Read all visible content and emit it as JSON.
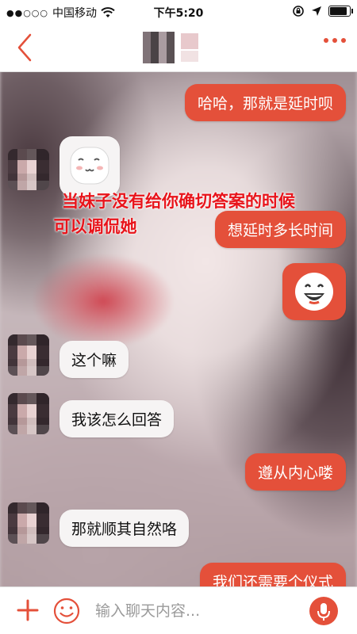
{
  "status_bar": {
    "signal_dots": "●●○○○",
    "carrier": "中国移动",
    "time": "下午5:20",
    "wifi_icon": "wifi-icon",
    "battery_level": 0.9
  },
  "nav": {
    "back_icon": "chevron-left-icon",
    "more_icon": "more-dots-icon"
  },
  "messages": [
    {
      "side": "right",
      "type": "text",
      "text": "哈哈，那就是延时呗"
    },
    {
      "side": "left",
      "type": "emoji",
      "emoji": "shy-face-emoji"
    },
    {
      "side": "right",
      "type": "text",
      "text": "想延时多长时间"
    },
    {
      "side": "right",
      "type": "emoji",
      "emoji": "grin-face-emoji"
    },
    {
      "side": "left",
      "type": "text",
      "text": "这个嘛"
    },
    {
      "side": "left",
      "type": "text",
      "text": "我该怎么回答"
    },
    {
      "side": "right",
      "type": "text",
      "text": "遵从内心喽"
    },
    {
      "side": "left",
      "type": "text",
      "text": "那就顺其自然咯"
    },
    {
      "side": "right",
      "type": "text",
      "text": "我们还需要个仪式"
    }
  ],
  "caption": {
    "line1": "当妹子没有给你确切答案的时候",
    "line2": "可以调侃她"
  },
  "input_bar": {
    "placeholder": "输入聊天内容...",
    "value": "",
    "plus_icon": "plus-icon",
    "emoji_icon": "smiley-icon",
    "mic_icon": "microphone-icon"
  },
  "colors": {
    "accent": "#e4503a",
    "caption": "#e8141b"
  }
}
